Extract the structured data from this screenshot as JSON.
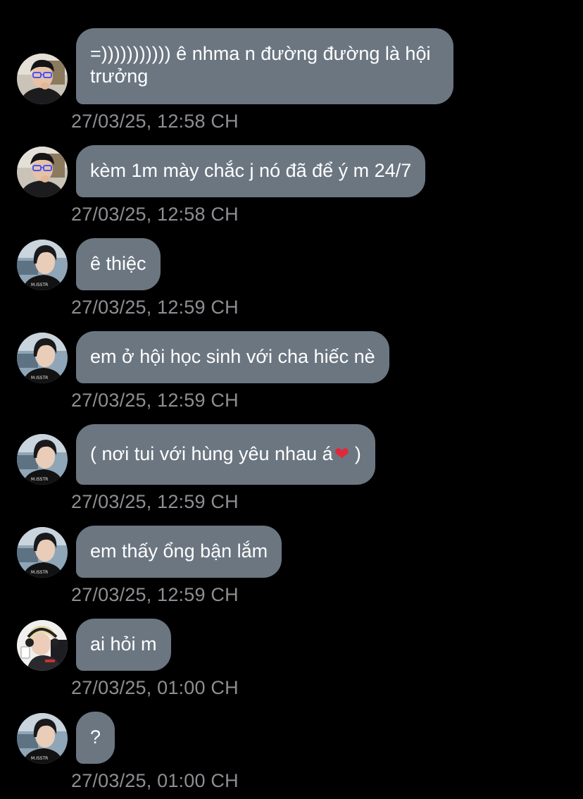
{
  "messages": [
    {
      "avatar": "avatar-glasses-boy",
      "text": "=))))))))))) ê nhma n đường đường là hội trưởng",
      "time": "27/03/25, 12:58 CH"
    },
    {
      "avatar": "avatar-glasses-boy",
      "text": "kèm 1m mày chắc j nó đã để ý m 24/7",
      "time": "27/03/25, 12:58 CH"
    },
    {
      "avatar": "avatar-dark-hair-boy",
      "text": "ê thiệc",
      "time": "27/03/25, 12:59 CH"
    },
    {
      "avatar": "avatar-dark-hair-boy",
      "text": "em ở hội học sinh với cha hiếc nè",
      "time": "27/03/25, 12:59 CH"
    },
    {
      "avatar": "avatar-dark-hair-boy",
      "text_before": "( nơi tui với hùng yêu nhau á",
      "emoji": "❤",
      "emoji_icon": "red-heart-icon",
      "text_after": " )",
      "time": "27/03/25, 12:59 CH"
    },
    {
      "avatar": "avatar-dark-hair-boy",
      "text": "em thấy ổng bận lắm",
      "time": "27/03/25, 12:59 CH"
    },
    {
      "avatar": "avatar-blonde-headset",
      "text": "ai hỏi m",
      "time": "27/03/25, 01:00 CH"
    },
    {
      "avatar": "avatar-dark-hair-boy",
      "text": "?",
      "time": "27/03/25, 01:00 CH"
    }
  ],
  "colors": {
    "background": "#000000",
    "bubble": "#6b7681",
    "bubble_text": "#ffffff",
    "timestamp": "#8e8e93",
    "heart": "#e0283a"
  }
}
